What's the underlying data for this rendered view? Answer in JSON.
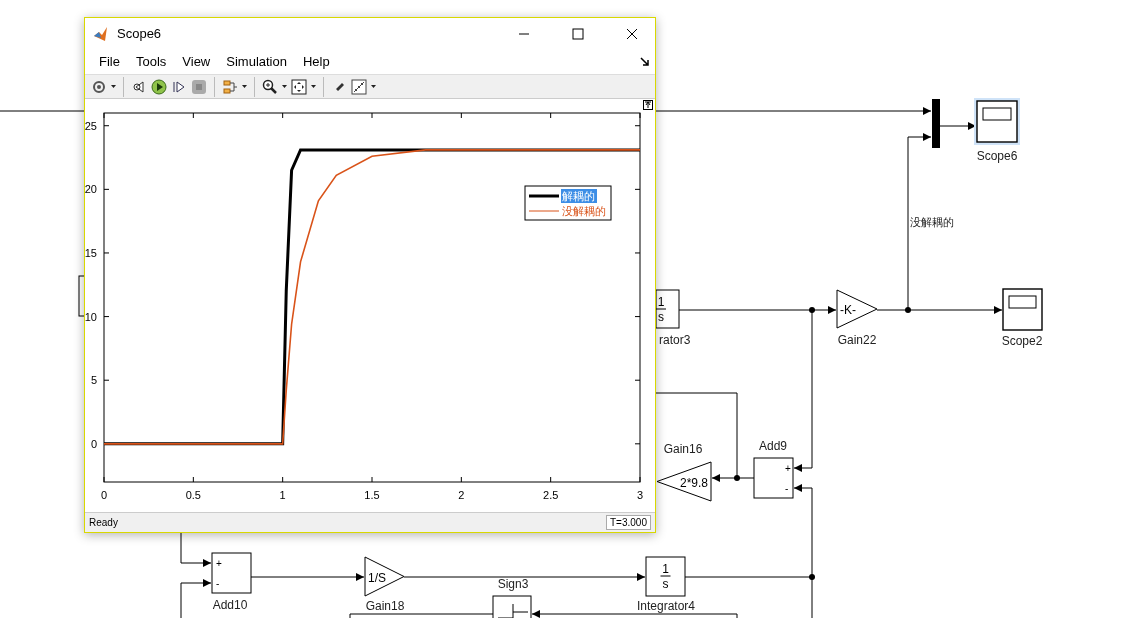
{
  "diagram": {
    "blocks": [
      {
        "kind": "mux"
      },
      {
        "kind": "scope",
        "label": "Scope6",
        "selected": true
      },
      {
        "kind": "integrator",
        "label": "rator3",
        "numerator": "1",
        "denominator": "s"
      },
      {
        "kind": "gain",
        "label": "Gain22",
        "text": "-K-"
      },
      {
        "kind": "scope",
        "label": "Scope2",
        "selected": false
      },
      {
        "kind": "gain_left",
        "label": "Gain16",
        "text": "2*9.8"
      },
      {
        "kind": "sum",
        "label": "Add9",
        "signs": [
          "+",
          "-"
        ]
      },
      {
        "kind": "sum",
        "label": "Add10",
        "signs": [
          "+",
          "-"
        ]
      },
      {
        "kind": "gain",
        "label": "Gain18",
        "text": "1/S"
      },
      {
        "kind": "sign",
        "label": "Sign3"
      },
      {
        "kind": "integrator",
        "label": "Integrator4",
        "numerator": "1",
        "denominator": "s"
      }
    ],
    "signal_label": "没解耦的"
  },
  "scope_window": {
    "title": "Scope6",
    "menu": [
      "File",
      "Tools",
      "View",
      "Simulation",
      "Help"
    ],
    "chart_data": {
      "type": "line",
      "x": [
        0,
        0.5,
        1,
        1.02,
        1.05,
        1.1,
        1.2,
        1.3,
        1.5,
        1.8,
        2,
        2.5,
        3
      ],
      "series": [
        {
          "name": "解耦的",
          "color": "#000000",
          "values": [
            0,
            0,
            0,
            12,
            21.5,
            23.1,
            23.1,
            23.1,
            23.1,
            23.1,
            23.1,
            23.1,
            23.1
          ]
        },
        {
          "name": "没解耦的",
          "color": "#d95319",
          "values": [
            0,
            0,
            0,
            4.2,
            9.4,
            14.3,
            19.1,
            21.1,
            22.6,
            23.1,
            23.1,
            23.1,
            23.1
          ]
        }
      ],
      "legend": true,
      "xlim": [
        0,
        3
      ],
      "ylim": [
        -3,
        26
      ],
      "xticks": [
        0,
        0.5,
        1,
        1.5,
        2,
        2.5,
        3
      ],
      "yticks": [
        0,
        5,
        10,
        15,
        20,
        25
      ]
    },
    "legend": [
      {
        "selected": true
      },
      {
        "selected": false
      }
    ],
    "status": "Ready",
    "time": "T=3.000"
  }
}
